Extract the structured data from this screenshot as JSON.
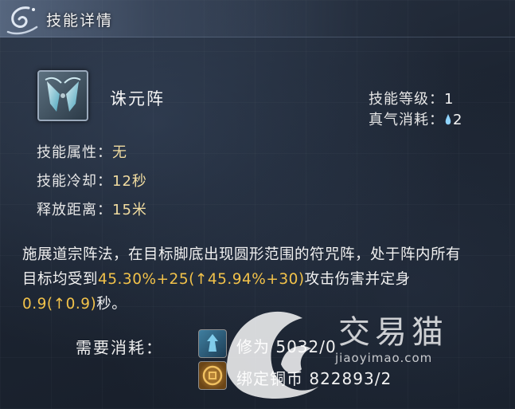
{
  "header": {
    "title": "技能详情"
  },
  "skill": {
    "name": "诛元阵",
    "level_label": "技能等级：",
    "level_value": "1",
    "qi_label": "真气消耗：",
    "qi_value": "2",
    "attr_label": "技能属性：",
    "attr_value": "无",
    "cooldown_label": "技能冷却：",
    "cooldown_value": "12秒",
    "range_label": "释放距离：",
    "range_value": "15米"
  },
  "description": {
    "part1": "施展道宗阵法，在目标脚底出现圆形范围的符咒阵，处于阵内所有目标均受到",
    "hl1": "45.30%+25(↑45.94%+30)",
    "part2": "攻击伤害并定身",
    "hl2": "0.9(↑0.9)",
    "part3": "秒。"
  },
  "cost": {
    "label": "需要消耗：",
    "items": [
      {
        "icon": "cultivation-icon",
        "text": "修为 5032/0"
      },
      {
        "icon": "bound-copper-coin-icon",
        "text": "绑定铜币 822893/2"
      }
    ]
  },
  "watermark": {
    "brand": "交易猫",
    "url": "jiaoyimao.com"
  },
  "colors": {
    "highlight": "#f2c24a",
    "value": "#f1dca0"
  }
}
